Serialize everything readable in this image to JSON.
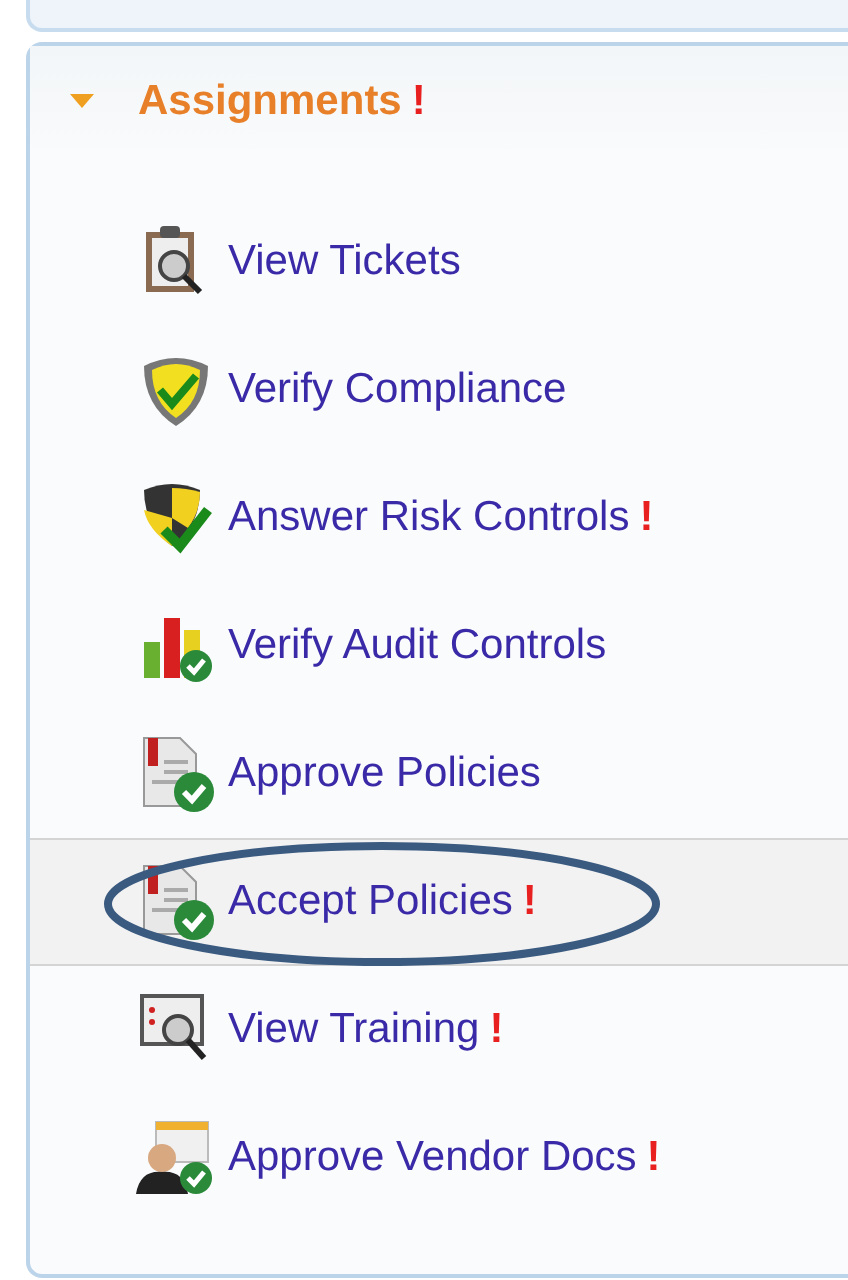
{
  "section": {
    "title": "Assignments",
    "expanded": true,
    "alert": true
  },
  "items": [
    {
      "label": "View Tickets",
      "kind": "tickets",
      "alert": false,
      "selected": false,
      "circled": false
    },
    {
      "label": "Verify Compliance",
      "kind": "compliance",
      "alert": false,
      "selected": false,
      "circled": false
    },
    {
      "label": "Answer Risk Controls",
      "kind": "risk",
      "alert": true,
      "selected": false,
      "circled": false
    },
    {
      "label": "Verify Audit Controls",
      "kind": "audit",
      "alert": false,
      "selected": false,
      "circled": false
    },
    {
      "label": "Approve Policies",
      "kind": "policy",
      "alert": false,
      "selected": false,
      "circled": false
    },
    {
      "label": "Accept Policies",
      "kind": "policy",
      "alert": true,
      "selected": true,
      "circled": true
    },
    {
      "label": "View Training",
      "kind": "training",
      "alert": true,
      "selected": false,
      "circled": false
    },
    {
      "label": "Approve Vendor Docs",
      "kind": "vendor",
      "alert": true,
      "selected": false,
      "circled": false
    }
  ],
  "alert_mark": "!"
}
